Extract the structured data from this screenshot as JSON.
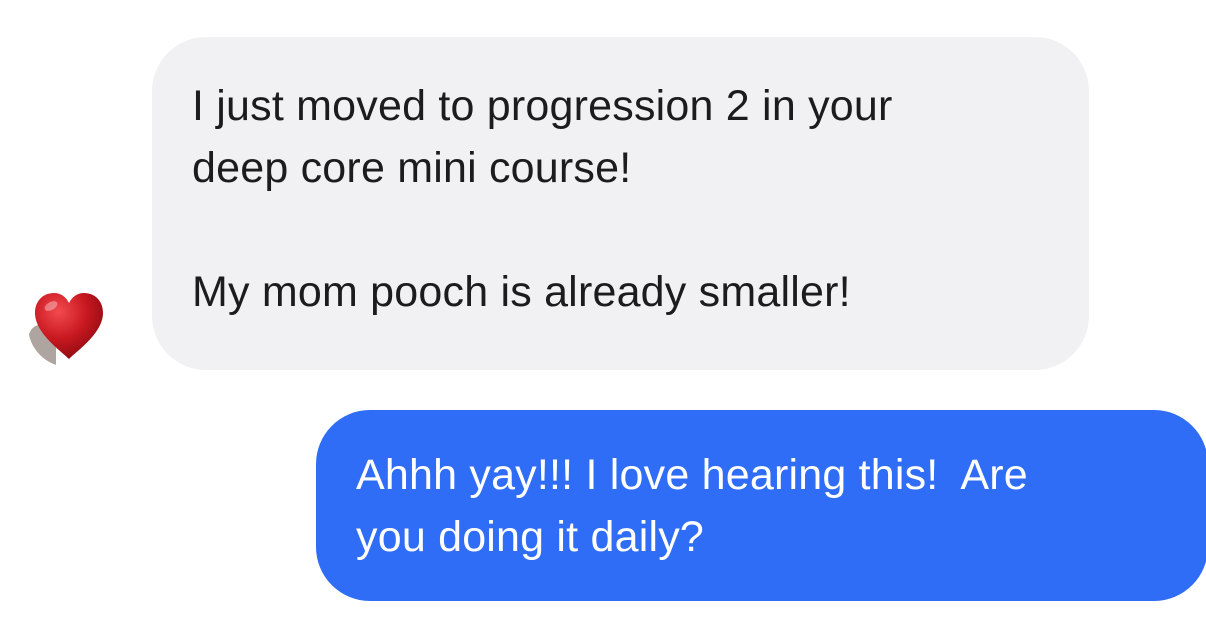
{
  "conversation": {
    "incoming_message": {
      "text": "I just moved to progression 2 in your\ndeep core mini course!\n\nMy mom pooch is already smaller!",
      "reaction_icon": "red-heart-icon"
    },
    "outgoing_message": {
      "text": "Ahhh yay!!! I love hearing this!  Are\nyou doing it daily?"
    }
  },
  "colors": {
    "incoming_bubble": "#f1f1f3",
    "outgoing_bubble": "#2f6df6",
    "heart": "#c81820"
  }
}
